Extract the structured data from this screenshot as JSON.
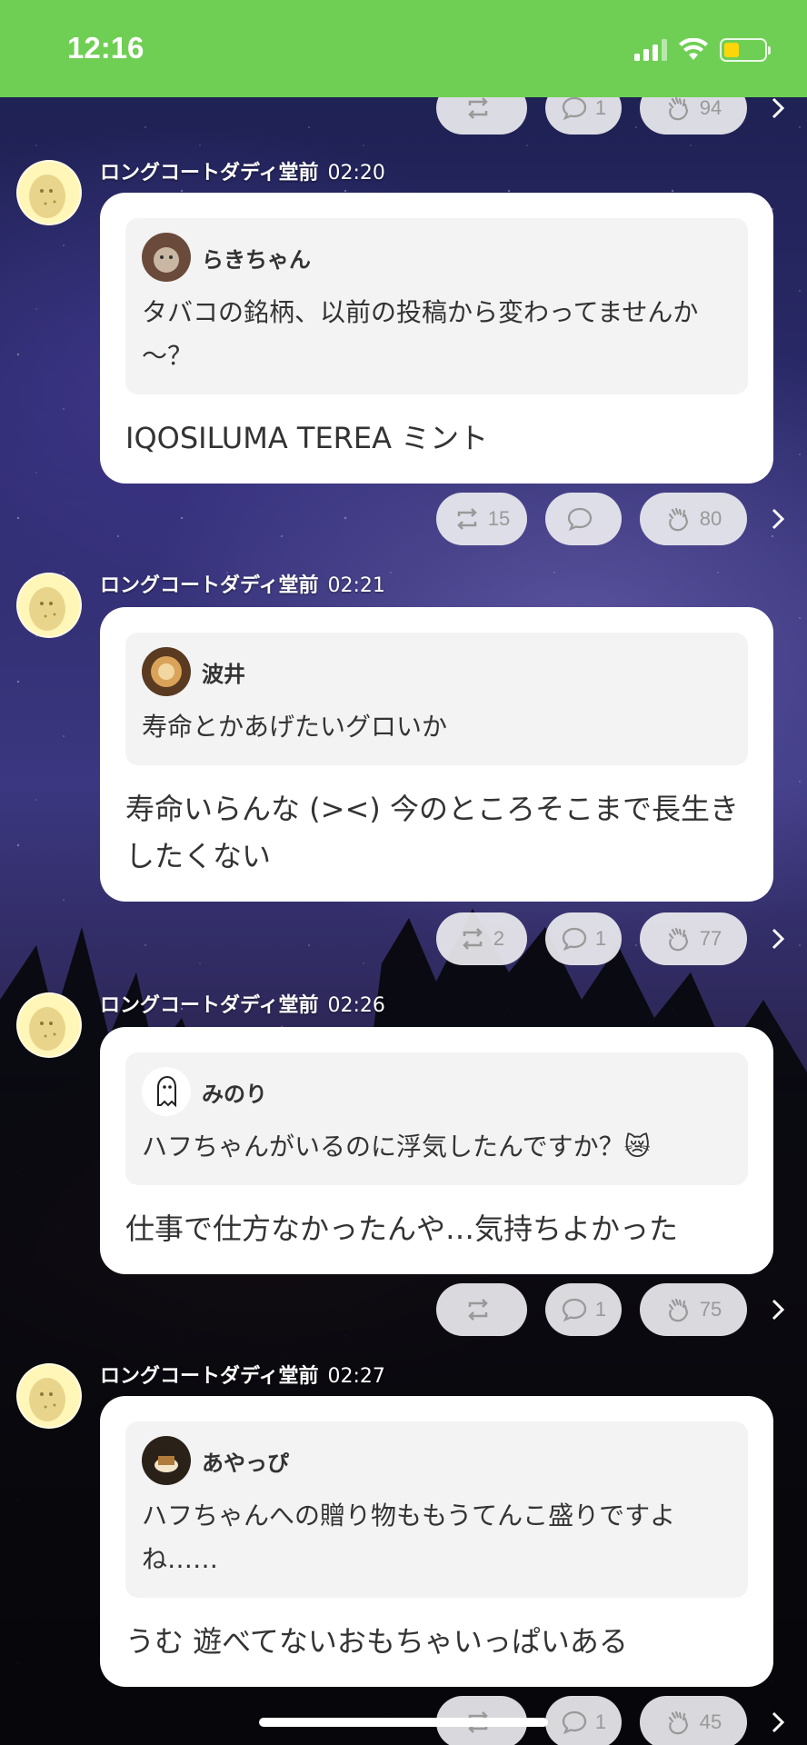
{
  "status_bar": {
    "time": "12:16",
    "colors": {
      "background": "#6fcf54",
      "battery": "#ffd60a"
    }
  },
  "top_partial_actions": {
    "repost_count": "",
    "comment_count": "1",
    "clap_count": "94"
  },
  "posts": [
    {
      "author": "ロングコートダディ堂前",
      "time": "02:20",
      "quote_name": "らきちゃん",
      "quote_text": "タバコの銘柄、以前の投稿から変わってませんか～？",
      "reply": "IQOSILUMA TEREA ミント",
      "repost_count": "15",
      "comment_count": "",
      "clap_count": "80"
    },
    {
      "author": "ロングコートダディ堂前",
      "time": "02:21",
      "quote_name": "波井",
      "quote_text": "寿命とかあげたいグロいか",
      "reply": "寿命いらんな (><) 今のところそこまで長生きしたくない",
      "repost_count": "2",
      "comment_count": "1",
      "clap_count": "77"
    },
    {
      "author": "ロングコートダディ堂前",
      "time": "02:26",
      "quote_name": "みのり",
      "quote_text": "ハフちゃんがいるのに浮気したんですか？😿",
      "reply": "仕事で仕方なかったんや…気持ちよかった",
      "repost_count": "",
      "comment_count": "1",
      "clap_count": "75"
    },
    {
      "author": "ロングコートダディ堂前",
      "time": "02:27",
      "quote_name": "あやっぴ",
      "quote_text": "ハフちゃんへの贈り物ももうてんこ盛りですよね……",
      "reply": "うむ 遊べてないおもちゃいっぱいある",
      "repost_count": "",
      "comment_count": "1",
      "clap_count": "45"
    }
  ],
  "icons": {
    "repost": "repost-icon",
    "comment": "comment-icon",
    "clap": "clap-icon",
    "chevron": "chevron-right-icon"
  }
}
